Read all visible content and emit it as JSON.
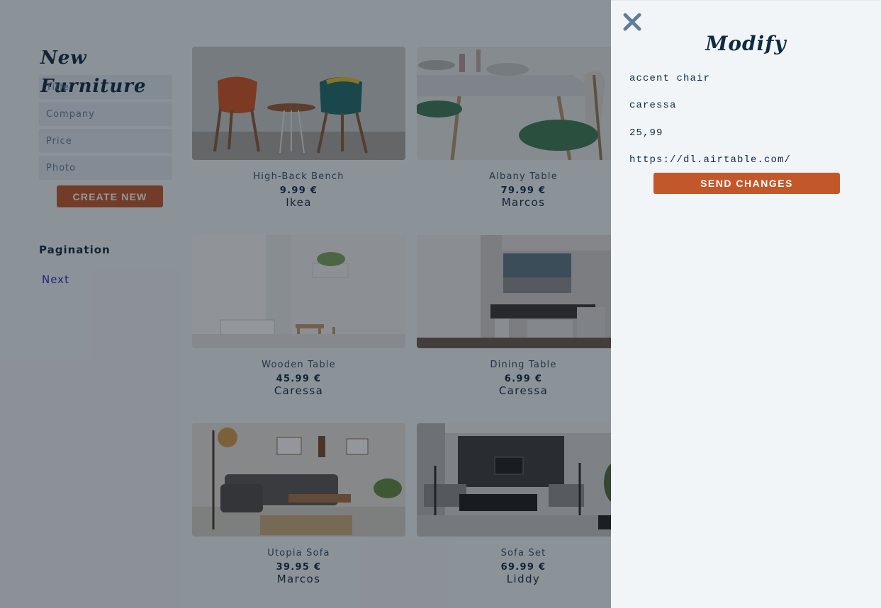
{
  "form": {
    "title": "New Furniture",
    "title_placeholder": "Title",
    "company_placeholder": "Company",
    "price_placeholder": "Price",
    "photo_placeholder": "Photo",
    "create_label": "CREATE NEW"
  },
  "pagination": {
    "title": "Pagination",
    "next_label": "Next"
  },
  "products": [
    {
      "title": "High-Back Bench",
      "price": "9.99 €",
      "company": "Ikea",
      "photo": "accent-chairs-photo"
    },
    {
      "title": "Albany Table",
      "price": "79.99 €",
      "company": "Marcos",
      "photo": "dining-set-photo"
    },
    {
      "title": "Wooden Table",
      "price": "45.99 €",
      "company": "Caressa",
      "photo": "white-room-photo"
    },
    {
      "title": "Dining Table",
      "price": "6.99 €",
      "company": "Caressa",
      "photo": "dining-room-photo"
    },
    {
      "title": "Utopia Sofa",
      "price": "39.95 €",
      "company": "Marcos",
      "photo": "living-room-photo"
    },
    {
      "title": "Sofa Set",
      "price": "69.99 €",
      "company": "Liddy",
      "photo": "lounge-photo"
    }
  ],
  "modal": {
    "title": "Modify",
    "title_value": "accent chair",
    "company_value": "caressa",
    "price_value": "25,99",
    "photo_value": "https://dl.airtable.com/",
    "send_label": "SEND CHANGES"
  },
  "colors": {
    "accent": "#c2582a",
    "heading": "#102a42",
    "background": "#f1f5f8",
    "link": "#2b2bcc"
  }
}
